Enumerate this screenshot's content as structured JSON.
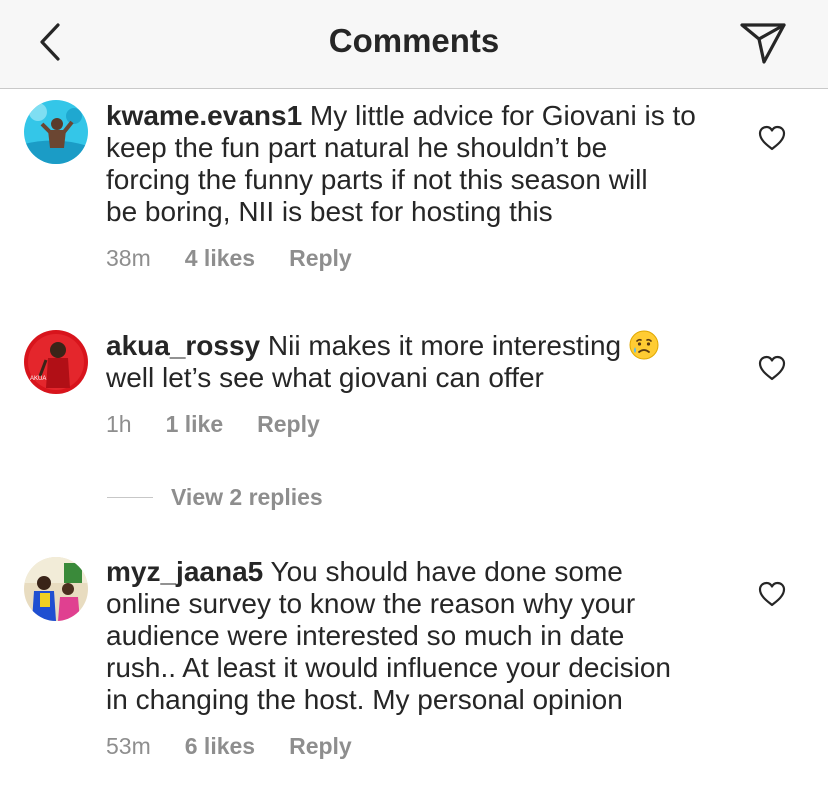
{
  "header": {
    "title": "Comments",
    "back_icon": "chevron-left-icon",
    "share_icon": "paper-plane-icon"
  },
  "comments": [
    {
      "username": "kwame.evans1",
      "text": " My little advice for Giovani is to\nkeep the fun part natural he shouldn’t be\nforcing the funny parts if not this season will\nbe boring, NII is best for hosting this",
      "time": "38m",
      "likes": "4 likes",
      "reply": "Reply"
    },
    {
      "username": "akua_rossy",
      "text": " Nii makes it more interesting ",
      "text_after_emoji": "\nwell let’s see what giovani can offer",
      "emoji": "sad-but-relieved-face-emoji",
      "time": "1h",
      "likes": "1 like",
      "reply": "Reply",
      "view_replies": "View 2 replies"
    },
    {
      "username": "myz_jaana5",
      "text": " You should have done some\nonline survey to know the reason why your\naudience were interested so much  in date\nrush.. At least it would influence your decision\nin changing the host. My personal opinion",
      "time": "53m",
      "likes": "6 likes",
      "reply": "Reply"
    }
  ],
  "colors": {
    "text": "#262626",
    "meta": "#8e8e8e",
    "header_bg": "#f7f7f7"
  }
}
